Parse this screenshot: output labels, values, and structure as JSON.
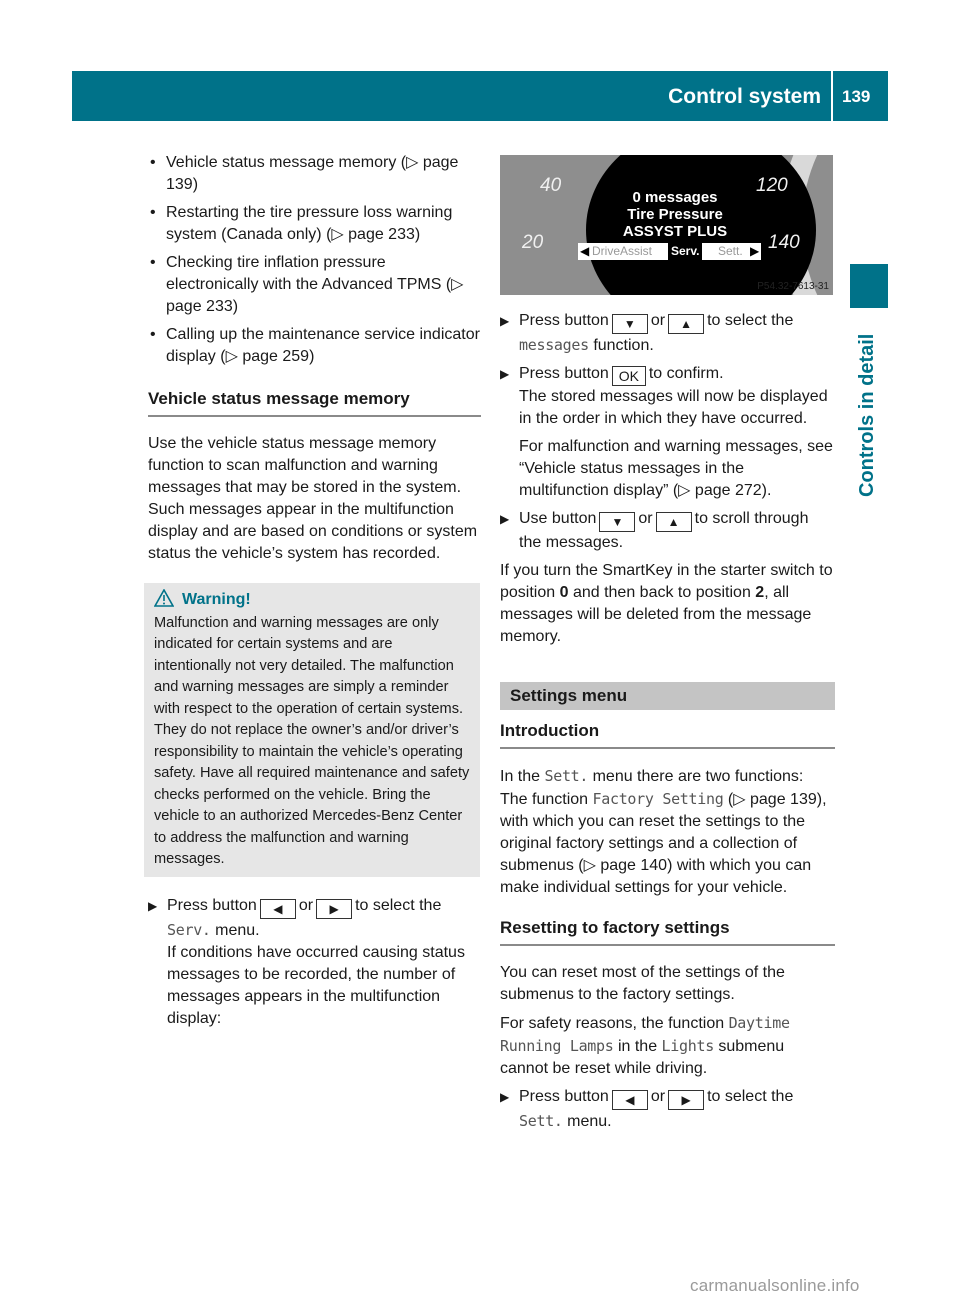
{
  "header": {
    "section_title": "Control system",
    "page_number": "139",
    "side_label": "Controls in detail",
    "accent_color": "#007289"
  },
  "left": {
    "bullets": [
      {
        "text": "Vehicle status message memory (",
        "ref": "page 139",
        "end": ")"
      },
      {
        "text": "Restarting the tire pressure loss warning system (Canada only) (",
        "ref": "page 233",
        "end": ")"
      },
      {
        "text": "Checking tire inflation pressure electronically with the Advanced TPMS (",
        "ref": "page 233",
        "end": ")"
      },
      {
        "text": "Calling up the maintenance service indicator display (",
        "ref": "page 259",
        "end": ")"
      }
    ],
    "heading": "Vehicle status message memory",
    "intro": "Use the vehicle status message memory function to scan malfunction and warning messages that may be stored in the system. Such messages appear in the multifunction display and are based on conditions or system status the vehicle’s system has recorded.",
    "warning": {
      "title": "Warning!",
      "icon": "warning-triangle-icon",
      "body": "Malfunction and warning messages are only indicated for certain systems and are intentionally not very detailed. The malfunction and warning messages are simply a reminder with respect to the operation of certain systems. They do not replace the owner’s and/or driver’s responsibility to maintain the vehicle’s operating safety. Have all required maintenance and safety checks performed on the vehicle. Bring the vehicle to an authorized Mercedes-Benz Center to address the malfunction and warning messages."
    },
    "step1": {
      "pre": "Press button",
      "key1": "◀",
      "or": "or",
      "key2": "▶",
      "post": "to select the",
      "mono": "Serv.",
      "post2": "menu.",
      "detail": "If conditions have occurred causing status messages to be recorded, the number of messages appears in the multifunction display:"
    }
  },
  "figure": {
    "speed_labels": [
      "20",
      "40",
      "120",
      "140"
    ],
    "lines": [
      "0 messages",
      "Tire Pressure",
      "ASSYST PLUS"
    ],
    "menu_left": "DriveAssist",
    "menu_selected": "Serv.",
    "menu_right": "Sett.",
    "figure_id": "P54.32-7613-31"
  },
  "right": {
    "step_a": {
      "pre": "Press button",
      "key1": "▼",
      "or": "or",
      "key2": "▲",
      "post": "to select the",
      "mono": "messages",
      "post2": "function."
    },
    "step_b": {
      "pre": "Press button",
      "key": "OK",
      "post": "to confirm.",
      "detail1": "The stored messages will now be displayed in the order in which they have occurred.",
      "detail2_pre": "For malfunction and warning messages, see “Vehicle status messages in the multifunction display” (",
      "detail2_ref": "page 272",
      "detail2_end": ")."
    },
    "step_c": {
      "pre": "Use button",
      "key1": "▼",
      "or": "or",
      "key2": "▲",
      "post": "to scroll through the messages."
    },
    "smartkey": {
      "a": "If you turn the SmartKey in the starter switch to position ",
      "b": "0",
      "c": " and then back to position ",
      "d": "2",
      "e": ", all messages will be deleted from the message memory."
    },
    "settings_band": "Settings menu",
    "intro_heading": "Introduction",
    "intro": {
      "a": "In the ",
      "m1": "Sett.",
      "b": " menu there are two functions: The function ",
      "m2": "Factory Setting",
      "c": " (",
      "ref1": "page 139",
      "d": "), with which you can reset the settings to the original factory settings and a collection of submenus (",
      "ref2": "page 140",
      "e": ") with which you can make individual settings for your vehicle."
    },
    "reset_heading": "Resetting to factory settings",
    "reset_p1": "You can reset most of the settings of the submenus to the factory settings.",
    "reset_p2": {
      "a": "For safety reasons, the function ",
      "m1": "Daytime Running Lamps",
      "b": " in the ",
      "m2": "Lights",
      "c": " submenu cannot be reset while driving."
    },
    "step_d": {
      "pre": "Press button",
      "key1": "◀",
      "or": "or",
      "key2": "▶",
      "post": "to select the",
      "mono": "Sett.",
      "post2": "menu."
    }
  },
  "watermark": "carmanualsonline.info"
}
